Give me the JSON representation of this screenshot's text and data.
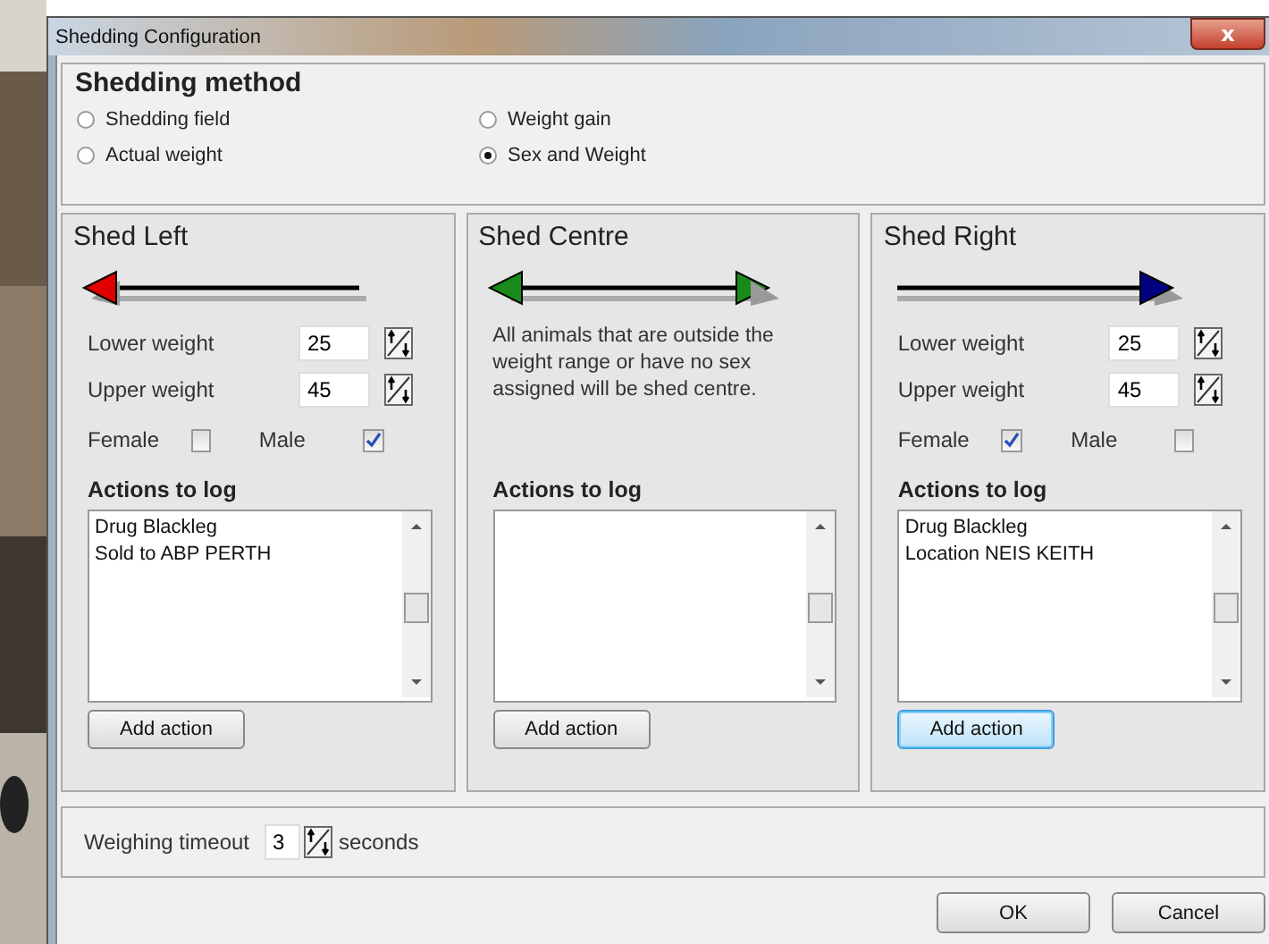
{
  "window": {
    "title": "Shedding Configuration",
    "close": "x"
  },
  "shedding_method": {
    "title": "Shedding method",
    "options": [
      {
        "label": "Shedding field",
        "selected": false
      },
      {
        "label": "Weight gain",
        "selected": false
      },
      {
        "label": "Actual weight",
        "selected": false
      },
      {
        "label": "Sex and Weight",
        "selected": true
      }
    ]
  },
  "panels": [
    {
      "kind": "left",
      "title": "Shed Left",
      "lower_label": "Lower weight",
      "lower": "25",
      "upper_label": "Upper weight",
      "upper": "45",
      "female_label": "Female",
      "female": false,
      "male_label": "Male",
      "male": true,
      "actions_title": "Actions to log",
      "actions": [
        "Drug Blackleg",
        "Sold to ABP PERTH"
      ],
      "button": "Add action",
      "focused": false
    },
    {
      "kind": "centre",
      "title": "Shed Centre",
      "description": "All animals that are outside the weight range or have no sex assigned will be shed centre.",
      "actions_title": "Actions to log",
      "button": "Add action",
      "focused": false
    },
    {
      "kind": "right",
      "title": "Shed Right",
      "lower_label": "Lower weight",
      "lower": "25",
      "upper_label": "Upper weight",
      "upper": "45",
      "female_label": "Female",
      "female": true,
      "male_label": "Male",
      "male": false,
      "actions_title": "Actions to log",
      "actions": [
        "Drug Blackleg",
        "Location NEIS KEITH"
      ],
      "button": "Add action",
      "focused": true
    }
  ],
  "timeout": {
    "label": "Weighing timeout",
    "value": "3",
    "unit": "seconds"
  },
  "buttons": [
    "OK",
    "Cancel"
  ]
}
